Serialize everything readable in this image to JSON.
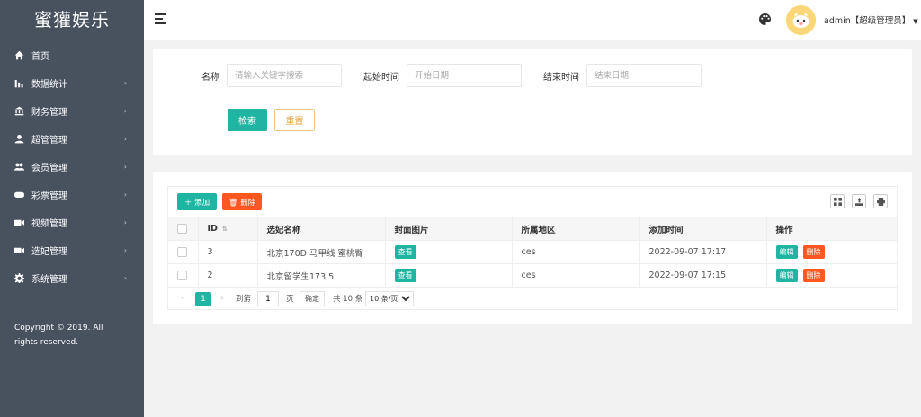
{
  "app": {
    "title": "蜜獾娱乐"
  },
  "sidebar": {
    "items": [
      {
        "label": "首页",
        "icon": "home-icon",
        "has_arrow": false
      },
      {
        "label": "数据统计",
        "icon": "chart-icon",
        "has_arrow": true
      },
      {
        "label": "财务管理",
        "icon": "bank-icon",
        "has_arrow": true
      },
      {
        "label": "超管管理",
        "icon": "user-icon",
        "has_arrow": true
      },
      {
        "label": "会员管理",
        "icon": "users-icon",
        "has_arrow": true
      },
      {
        "label": "彩票管理",
        "icon": "gamepad-icon",
        "has_arrow": true
      },
      {
        "label": "视频管理",
        "icon": "video-icon",
        "has_arrow": true
      },
      {
        "label": "选妃管理",
        "icon": "video-icon",
        "has_arrow": true
      },
      {
        "label": "系统管理",
        "icon": "gear-icon",
        "has_arrow": true
      }
    ],
    "copyright": "Copyright © 2019. All rights reserved."
  },
  "header": {
    "user": "admin【超级管理员】"
  },
  "search": {
    "name_label": "名称",
    "name_placeholder": "请输入关键字搜索",
    "start_label": "起始时间",
    "start_placeholder": "开始日期",
    "end_label": "结束时间",
    "end_placeholder": "结束日期",
    "search_button": "检索",
    "reset_button": "重置"
  },
  "toolbar": {
    "add_label": "添加",
    "delete_label": "删除"
  },
  "table": {
    "columns": [
      "ID",
      "选妃名称",
      "封面图片",
      "所属地区",
      "添加时间",
      "操作"
    ],
    "rows": [
      {
        "id": "3",
        "name": "北京170D 马甲线 蜜桃臀",
        "cover": "查看",
        "region": "ces",
        "time": "2022-09-07 17:17",
        "edit": "编辑",
        "delete": "删除"
      },
      {
        "id": "2",
        "name": "北京留学生173 5",
        "cover": "查看",
        "region": "ces",
        "time": "2022-09-07 17:15",
        "edit": "编辑",
        "delete": "删除"
      }
    ]
  },
  "pager": {
    "current": "1",
    "goto_label": "到第",
    "goto_value": "1",
    "page_unit": "页",
    "confirm": "确定",
    "total": "共 10 条",
    "page_size": "10 条/页"
  },
  "colors": {
    "sidebar": "#48525f",
    "primary": "#1fb5a2",
    "danger": "#ff5722",
    "warning": "#f3cc7a"
  }
}
